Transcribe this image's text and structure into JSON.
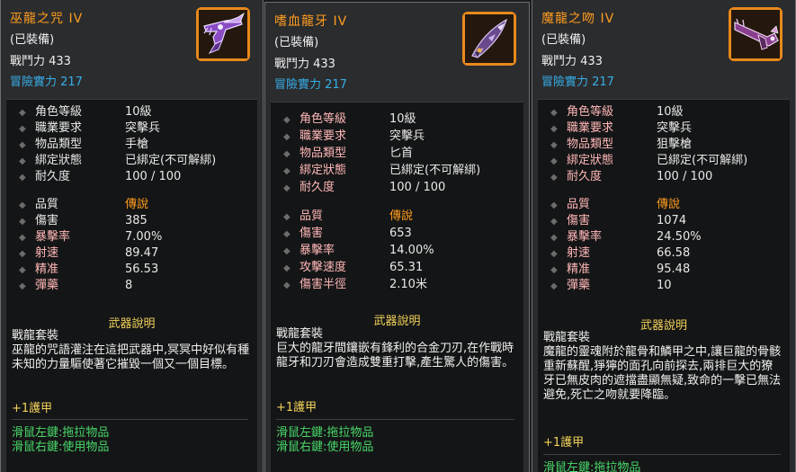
{
  "cards": [
    {
      "name": "巫龍之咒  IV",
      "equipped": "(已裝備)",
      "combat_power": "戰鬥力 433",
      "adventure_power": "冒險實力 217",
      "icon": "violet-skull-pistol-icon",
      "stats1": [
        {
          "label": "角色等級",
          "value": "10級"
        },
        {
          "label": "職業要求",
          "value": "突擊兵"
        },
        {
          "label": "物品類型",
          "value": "手槍"
        },
        {
          "label": "綁定狀態",
          "value": "已綁定(不可解綁)"
        },
        {
          "label": "耐久度",
          "value": "100  /  100"
        }
      ],
      "stats2": [
        {
          "label": "品質",
          "value": "傳說"
        },
        {
          "label": "傷害",
          "value": "385"
        },
        {
          "label": "暴擊率",
          "value": "7.00%"
        },
        {
          "label": "射速",
          "value": "89.47"
        },
        {
          "label": "精准",
          "value": "56.53"
        },
        {
          "label": "彈藥",
          "value": "8"
        }
      ],
      "desc_title": "武器說明",
      "set_name": "戰龍套裝",
      "description": "巫龍的咒語灌注在這把武器中,冥冥中好似有種未知的力量驅使著它摧毀一個又一個目標。",
      "bonus": "+1護甲",
      "hint_left": "滑鼠左鍵:拖拉物品",
      "hint_right": "滑鼠右鍵:使用物品"
    },
    {
      "name": "嗜血龍牙  IV",
      "equipped": "(已裝備)",
      "combat_power": "戰鬥力 433",
      "adventure_power": "冒險實力 217",
      "icon": "dragon-fang-dagger-icon",
      "stats1": [
        {
          "label": "角色等級",
          "value": "10級"
        },
        {
          "label": "職業要求",
          "value": "突擊兵"
        },
        {
          "label": "物品類型",
          "value": "匕首"
        },
        {
          "label": "綁定狀態",
          "value": "已綁定(不可解綁)"
        },
        {
          "label": "耐久度",
          "value": "100  /  100"
        }
      ],
      "stats2": [
        {
          "label": "品質",
          "value": "傳說"
        },
        {
          "label": "傷害",
          "value": "653"
        },
        {
          "label": "暴擊率",
          "value": "14.00%"
        },
        {
          "label": "攻擊速度",
          "value": "65.31"
        },
        {
          "label": "傷害半徑",
          "value": "2.10米"
        }
      ],
      "desc_title": "武器說明",
      "set_name": "戰龍套裝",
      "description": "巨大的龍牙間鑲嵌有鋒利的合金刀刃,在作戰時龍牙和刀刃會造成雙重打擊,產生驚人的傷害。",
      "bonus": "+1護甲",
      "hint_left": "滑鼠左鍵:拖拉物品",
      "hint_right": "滑鼠右鍵:使用物品"
    },
    {
      "name": "魔龍之吻  IV",
      "equipped": "(已裝備)",
      "combat_power": "戰鬥力 433",
      "adventure_power": "冒險實力 217",
      "icon": "dragon-sniper-rifle-icon",
      "stats1": [
        {
          "label": "角色等級",
          "value": "10級"
        },
        {
          "label": "職業要求",
          "value": "突擊兵"
        },
        {
          "label": "物品類型",
          "value": "狙擊槍"
        },
        {
          "label": "綁定狀態",
          "value": "已綁定(不可解綁)"
        },
        {
          "label": "耐久度",
          "value": "100  /  100"
        }
      ],
      "stats2": [
        {
          "label": "品質",
          "value": "傳說"
        },
        {
          "label": "傷害",
          "value": "1074"
        },
        {
          "label": "暴擊率",
          "value": "24.50%"
        },
        {
          "label": "射速",
          "value": "66.58"
        },
        {
          "label": "精准",
          "value": "95.48"
        },
        {
          "label": "彈藥",
          "value": "10"
        }
      ],
      "desc_title": "武器說明",
      "set_name": "戰龍套裝",
      "description": "魔龍的靈魂附於龍骨和鱗甲之中,讓巨龍的骨骸重新蘇醒,猙獰的面孔向前探去,兩排巨大的獠牙已無皮肉的遮擋盡顯無疑,致命的一擊已無法避免,死亡之吻就要降臨。",
      "bonus": "+1護甲",
      "hint_left": "滑鼠左鍵:拖拉物品"
    }
  ]
}
